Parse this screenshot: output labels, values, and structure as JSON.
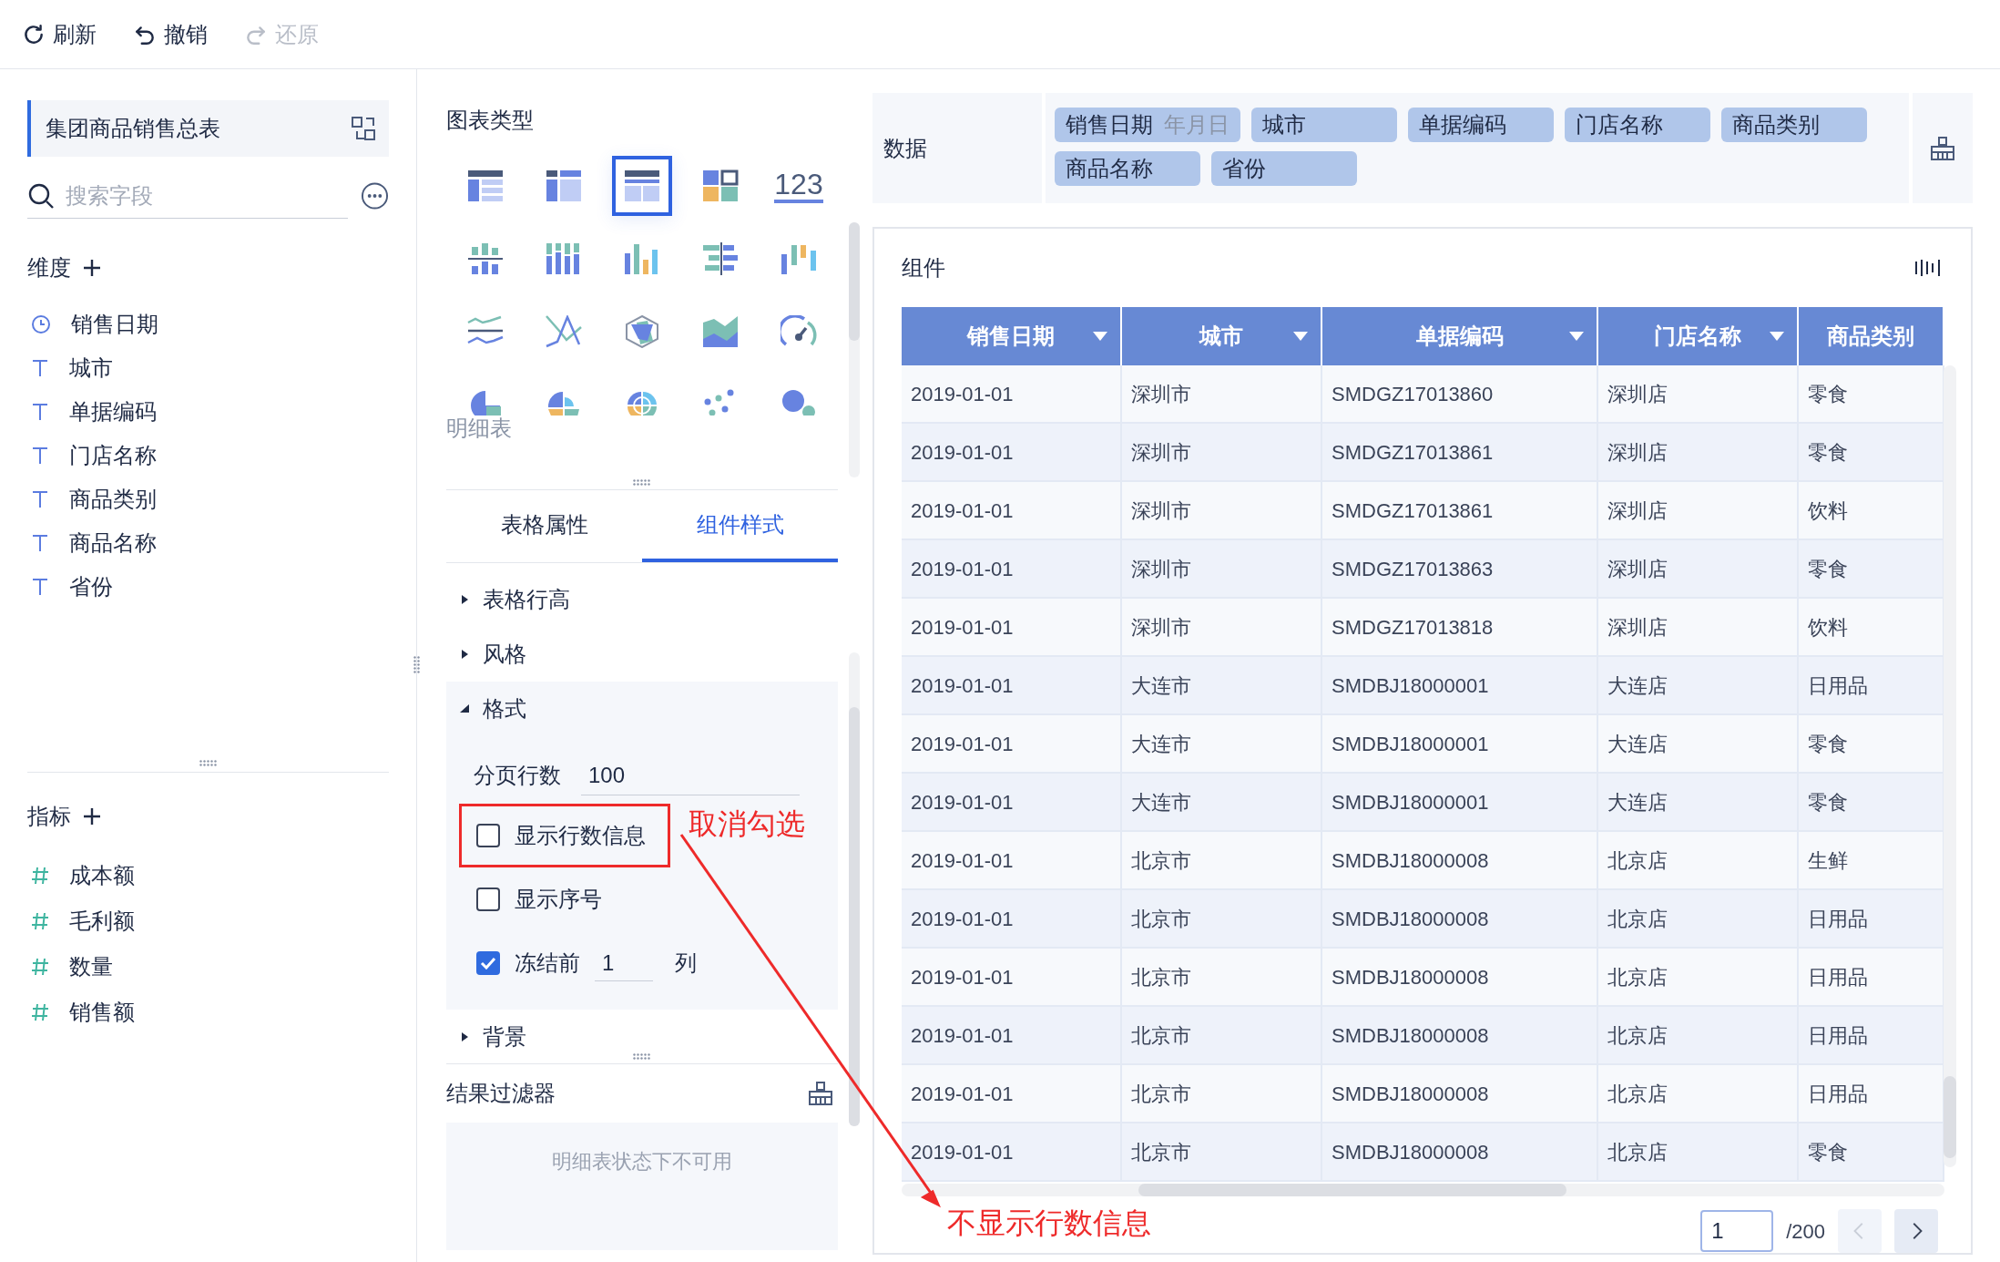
{
  "toolbar": [
    {
      "kind": "refresh",
      "label": "刷新",
      "disabled": false
    },
    {
      "kind": "undo",
      "label": "撤销",
      "disabled": false
    },
    {
      "kind": "redo",
      "label": "还原",
      "disabled": true
    }
  ],
  "sidebar": {
    "title": "集团商品销售总表",
    "search": {
      "placeholder": "搜索字段"
    },
    "dimensions": {
      "title": "维度",
      "fields": [
        {
          "kind": "date",
          "label": "销售日期"
        },
        {
          "kind": "text",
          "label": "城市"
        },
        {
          "kind": "text",
          "label": "单据编码"
        },
        {
          "kind": "text",
          "label": "门店名称"
        },
        {
          "kind": "text",
          "label": "商品类别"
        },
        {
          "kind": "text",
          "label": "商品名称"
        },
        {
          "kind": "text",
          "label": "省份"
        }
      ]
    },
    "metrics": {
      "title": "指标",
      "fields": [
        {
          "kind": "number",
          "label": "成本额"
        },
        {
          "kind": "number",
          "label": "毛利额"
        },
        {
          "kind": "number",
          "label": "数量"
        },
        {
          "kind": "number",
          "label": "销售额"
        }
      ]
    }
  },
  "chart_types": {
    "title": "图表类型",
    "selected_label": "明细表",
    "items": [
      {
        "kind": "cross-table",
        "selected": false
      },
      {
        "kind": "group-table",
        "selected": false
      },
      {
        "kind": "detail-table",
        "selected": true
      },
      {
        "kind": "dashboard",
        "selected": false
      },
      {
        "kind": "number",
        "label": "123",
        "selected": false
      },
      {
        "kind": "split-bar",
        "selected": false
      },
      {
        "kind": "stack-bar",
        "selected": false
      },
      {
        "kind": "bar",
        "selected": false
      },
      {
        "kind": "compare-bar",
        "selected": false
      },
      {
        "kind": "range-bar",
        "selected": false
      },
      {
        "kind": "split-line",
        "selected": false
      },
      {
        "kind": "line",
        "selected": false
      },
      {
        "kind": "radar",
        "selected": false
      },
      {
        "kind": "area",
        "selected": false
      },
      {
        "kind": "gauge",
        "selected": false
      },
      {
        "kind": "pie",
        "selected": false
      },
      {
        "kind": "rose",
        "selected": false
      },
      {
        "kind": "multi-pie",
        "selected": false
      },
      {
        "kind": "scatter",
        "selected": false
      },
      {
        "kind": "bubble",
        "selected": false
      }
    ]
  },
  "tabs": [
    {
      "label": "表格属性",
      "selected": false
    },
    {
      "label": "组件样式",
      "selected": true
    }
  ],
  "sections": [
    {
      "label": "表格行高",
      "expanded": false
    },
    {
      "label": "风格",
      "expanded": false
    },
    {
      "label": "格式",
      "expanded": true
    },
    {
      "label": "背景",
      "expanded": false
    }
  ],
  "format": {
    "page_rows": {
      "label": "分页行数",
      "value": "100"
    },
    "options": [
      {
        "kind": "checkbox",
        "label": "显示行数信息",
        "checked": false,
        "highlighted": true
      },
      {
        "kind": "checkbox",
        "label": "显示序号",
        "checked": false,
        "highlighted": false
      },
      {
        "kind": "freeze",
        "label": "冻结前",
        "value": "1",
        "suffix": "列",
        "checked": true,
        "highlighted": false
      }
    ]
  },
  "result_filter": {
    "title": "结果过滤器",
    "message": "明细表状态下不可用"
  },
  "data_bar": {
    "label": "数据",
    "tags": [
      {
        "label": "销售日期",
        "sub": "年月日"
      },
      {
        "label": "城市"
      },
      {
        "label": "单据编码"
      },
      {
        "label": "门店名称"
      },
      {
        "label": "商品类别"
      },
      {
        "label": "商品名称"
      },
      {
        "label": "省份"
      }
    ]
  },
  "component": {
    "title": "组件",
    "table": {
      "columns": [
        "销售日期",
        "城市",
        "单据编码",
        "门店名称",
        "商品类别"
      ],
      "rows": [
        [
          "2019-01-01",
          "深圳市",
          "SMDGZ17013860",
          "深圳店",
          "零食"
        ],
        [
          "2019-01-01",
          "深圳市",
          "SMDGZ17013861",
          "深圳店",
          "零食"
        ],
        [
          "2019-01-01",
          "深圳市",
          "SMDGZ17013861",
          "深圳店",
          "饮料"
        ],
        [
          "2019-01-01",
          "深圳市",
          "SMDGZ17013863",
          "深圳店",
          "零食"
        ],
        [
          "2019-01-01",
          "深圳市",
          "SMDGZ17013818",
          "深圳店",
          "饮料"
        ],
        [
          "2019-01-01",
          "大连市",
          "SMDBJ18000001",
          "大连店",
          "日用品"
        ],
        [
          "2019-01-01",
          "大连市",
          "SMDBJ18000001",
          "大连店",
          "零食"
        ],
        [
          "2019-01-01",
          "大连市",
          "SMDBJ18000001",
          "大连店",
          "零食"
        ],
        [
          "2019-01-01",
          "北京市",
          "SMDBJ18000008",
          "北京店",
          "生鲜"
        ],
        [
          "2019-01-01",
          "北京市",
          "SMDBJ18000008",
          "北京店",
          "日用品"
        ],
        [
          "2019-01-01",
          "北京市",
          "SMDBJ18000008",
          "北京店",
          "日用品"
        ],
        [
          "2019-01-01",
          "北京市",
          "SMDBJ18000008",
          "北京店",
          "日用品"
        ],
        [
          "2019-01-01",
          "北京市",
          "SMDBJ18000008",
          "北京店",
          "日用品"
        ],
        [
          "2019-01-01",
          "北京市",
          "SMDBJ18000008",
          "北京店",
          "零食"
        ]
      ]
    },
    "pagination": {
      "page": "1",
      "total": "/200",
      "prev_disabled": true,
      "next_disabled": false
    }
  },
  "annotations": [
    {
      "text": "取消勾选"
    },
    {
      "text": "不显示行数信息"
    }
  ]
}
